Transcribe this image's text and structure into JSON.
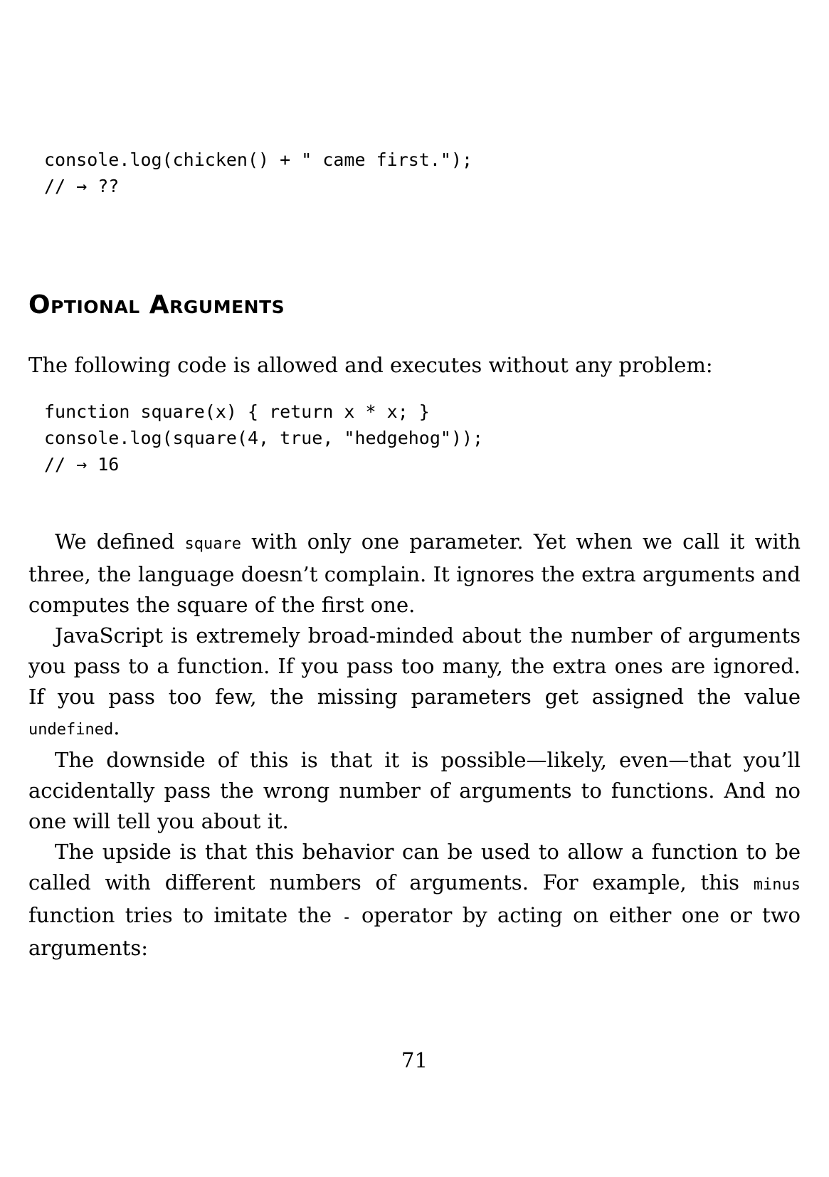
{
  "code_top": {
    "lines": [
      "console.log(chicken() + \" came first.\");",
      "// → ??"
    ]
  },
  "section": {
    "title": "Optional Arguments"
  },
  "intro": {
    "text": "The following code is allowed and executes without any problem:"
  },
  "code_example": {
    "lines": [
      "function square(x) { return x * x; }",
      "console.log(square(4, true, \"hedgehog\"));",
      "// → 16"
    ]
  },
  "paragraphs": {
    "p1": {
      "a": "We defined ",
      "code": "square",
      "b": " with only one parameter. Yet when we call it with three, the language doesn’t complain. It ignores the extra arguments and computes the square of the first one."
    },
    "p2": {
      "a": "JavaScript is extremely broad-minded about the number of arguments you pass to a function. If you pass too many, the extra ones are ignored. If you pass too few, the missing parameters get assigned the value ",
      "code": "undefined",
      "b": "."
    },
    "p3": {
      "text": "The downside of this is that it is possible—likely, even—that you’ll accidentally pass the wrong number of arguments to functions. And no one will tell you about it."
    },
    "p4": {
      "a": "The upside is that this behavior can be used to allow a function to be called with different numbers of arguments. For example, this ",
      "code": "minus",
      "b": " function tries to imitate the ",
      "code2": "-",
      "c": " operator by acting on either one or two arguments:"
    }
  },
  "page_number": "71"
}
